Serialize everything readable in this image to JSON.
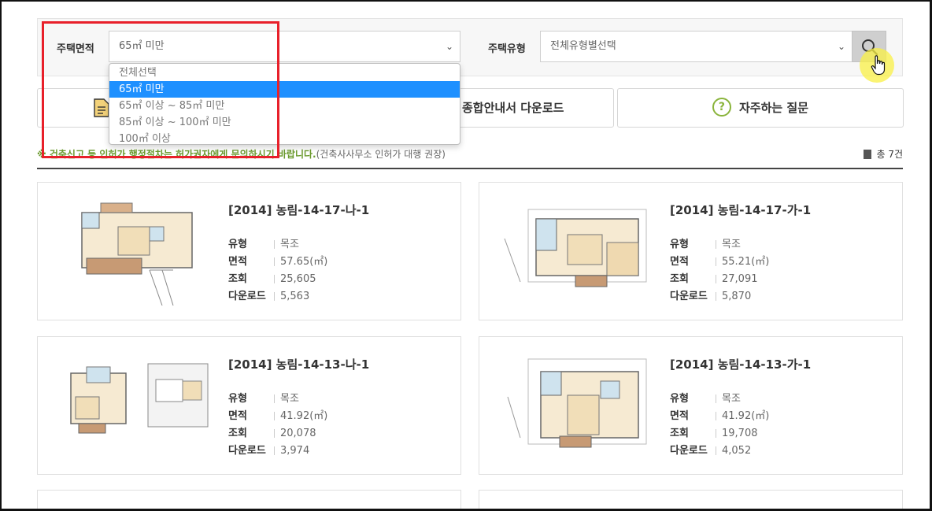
{
  "filters": {
    "area_label": "주택면적",
    "area_selected": "65㎡ 미만",
    "type_label": "주택유형",
    "type_selected": "전체유형별선택",
    "area_options": [
      "전체선택",
      "65㎡ 미만",
      "65㎡ 이상 ~ 85㎡ 미만",
      "85㎡ 이상 ~ 100㎡ 미만",
      "100㎡ 이상"
    ],
    "area_selected_index": 1
  },
  "actions": {
    "download_label": "종합안내서 다운로드",
    "faq_label": "자주하는 질문",
    "faq_icon": "?"
  },
  "notice": {
    "highlight": "※ 건축신고 등 인허가 행정절차는 허가권자에게 문의하시기 바랍니다.",
    "note": "(건축사사무소 인허가 대행 권장)"
  },
  "total": "총 7건",
  "spec_labels": {
    "type": "유형",
    "area": "면적",
    "views": "조회",
    "downloads": "다운로드"
  },
  "cards": [
    {
      "title": "[2014] 농림-14-17-나-1",
      "type": "목조",
      "area": "57.65(㎡)",
      "views": "25,605",
      "downloads": "5,563"
    },
    {
      "title": "[2014] 농림-14-17-가-1",
      "type": "목조",
      "area": "55.21(㎡)",
      "views": "27,091",
      "downloads": "5,870"
    },
    {
      "title": "[2014] 농림-14-13-나-1",
      "type": "목조",
      "area": "41.92(㎡)",
      "views": "20,078",
      "downloads": "3,974"
    },
    {
      "title": "[2014] 농림-14-13-가-1",
      "type": "목조",
      "area": "41.92(㎡)",
      "views": "19,708",
      "downloads": "4,052"
    }
  ],
  "colors": {
    "accent_green": "#8ab43b",
    "selected_blue": "#1e90ff",
    "highlight_red": "#e8202a",
    "cursor_yellow": "#faf046"
  }
}
